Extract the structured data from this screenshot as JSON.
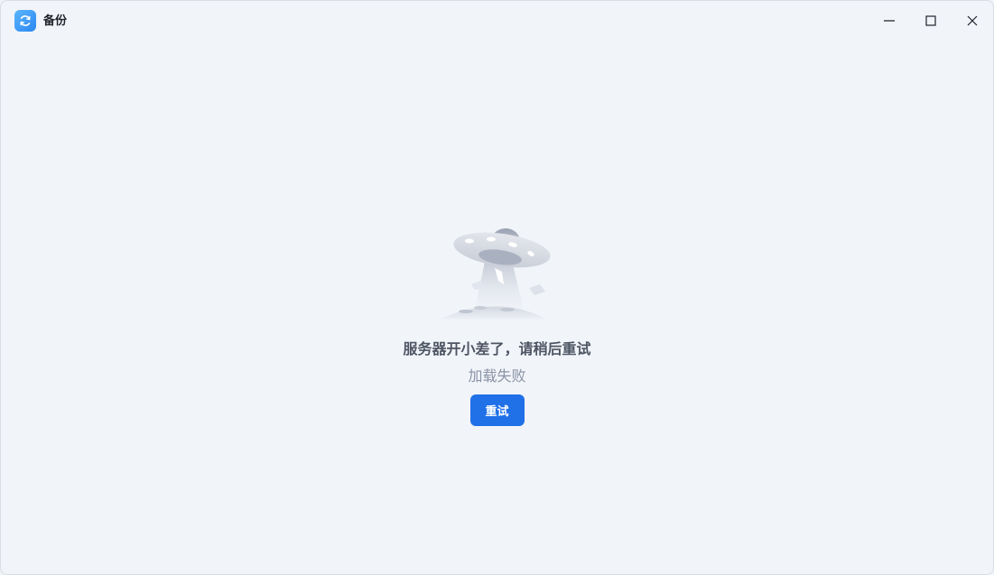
{
  "window": {
    "title": "备份",
    "controls": {
      "minimize": "minimize-icon",
      "maximize": "maximize-icon",
      "close": "close-icon"
    }
  },
  "content": {
    "illustration": "ufo-illustration",
    "error_title": "服务器开小差了，请稍后重试",
    "error_subtitle": "加载失败",
    "retry_label": "重试"
  },
  "colors": {
    "accent": "#2070e8",
    "background": "#f1f4f9",
    "title_text": "#4e5563",
    "subtitle_text": "#8a93a6"
  }
}
